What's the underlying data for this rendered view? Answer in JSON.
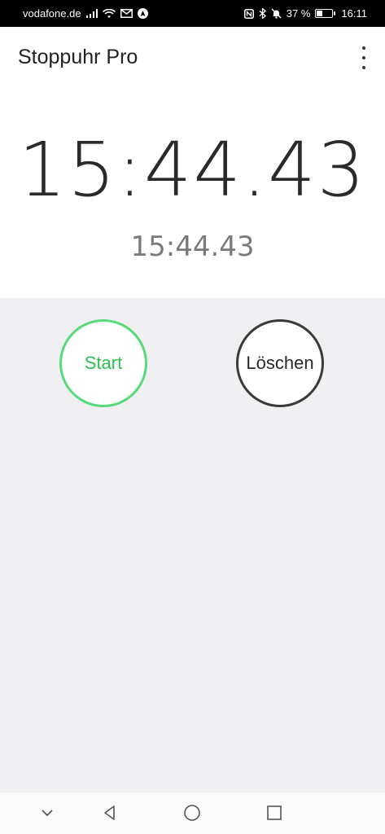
{
  "status_bar": {
    "carrier": "vodafone.de",
    "battery_percent": "37 %",
    "battery_level": 0.37,
    "time": "16:11",
    "icons": [
      "signal-icon",
      "wifi-icon",
      "mail-icon",
      "navigation-icon",
      "nfc-icon",
      "bluetooth-icon",
      "silent-icon",
      "battery-icon"
    ]
  },
  "app_bar": {
    "title": "Stoppuhr Pro",
    "menu_icon": "more-vert-icon"
  },
  "timer": {
    "main_time": "15:44.43",
    "lap_time": "15:44.43"
  },
  "buttons": {
    "start_label": "Start",
    "clear_label": "Löschen",
    "start_color": "#58d97a",
    "clear_color": "#3a3a3a"
  },
  "nav_bar": {
    "icons": [
      "chevron-down-icon",
      "back-icon",
      "home-icon",
      "recents-icon"
    ]
  }
}
